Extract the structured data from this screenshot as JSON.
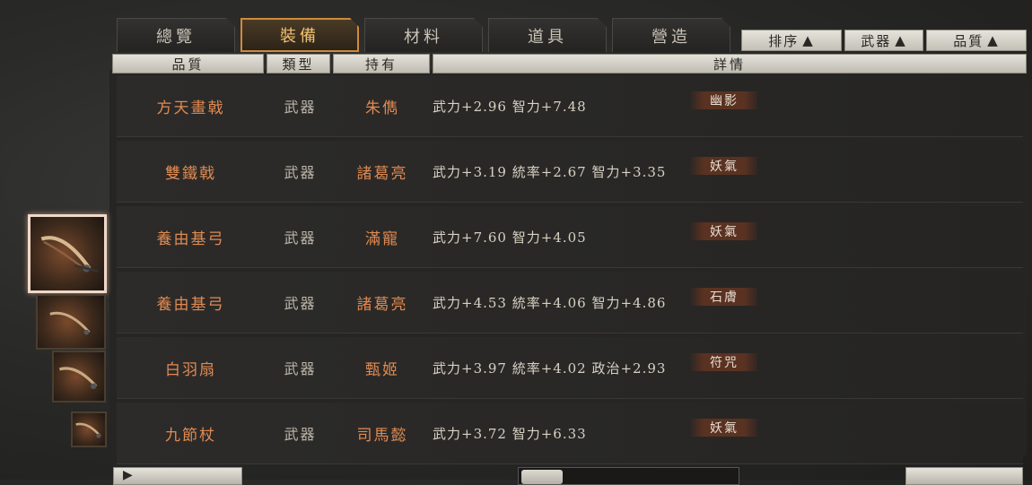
{
  "tabs": [
    {
      "label": "總覽",
      "active": false
    },
    {
      "label": "裝備",
      "active": true
    },
    {
      "label": "材料",
      "active": false
    },
    {
      "label": "道具",
      "active": false
    },
    {
      "label": "營造",
      "active": false
    }
  ],
  "sort_buttons": [
    {
      "label": "排序",
      "icon": "triangle-up-icon"
    },
    {
      "label": "武器",
      "icon": "triangle-up-icon"
    },
    {
      "label": "品質",
      "icon": "triangle-up-icon"
    }
  ],
  "columns": [
    "品質",
    "類型",
    "持有",
    "詳情"
  ],
  "rows": [
    {
      "name": "方天畫戟",
      "type": "武器",
      "owner": "朱儁",
      "stats": "武力+2.96  智力+7.48",
      "tag": "幽影"
    },
    {
      "name": "雙鐵戟",
      "type": "武器",
      "owner": "諸葛亮",
      "stats": "武力+3.19  統率+2.67  智力+3.35",
      "tag": "妖氣"
    },
    {
      "name": "養由基弓",
      "type": "武器",
      "owner": "滿寵",
      "stats": "武力+7.60  智力+4.05",
      "tag": "妖氣"
    },
    {
      "name": "養由基弓",
      "type": "武器",
      "owner": "諸葛亮",
      "stats": "武力+4.53  統率+4.06  智力+4.86",
      "tag": "石膚"
    },
    {
      "name": "白羽扇",
      "type": "武器",
      "owner": "甄姬",
      "stats": "武力+3.97  統率+4.02  政治+2.93",
      "tag": "符咒"
    },
    {
      "name": "九節杖",
      "type": "武器",
      "owner": "司馬懿",
      "stats": "武力+3.72  智力+6.33",
      "tag": "妖氣"
    }
  ],
  "thumbnails": [
    {
      "icon": "bow-weapon-icon",
      "selected": true
    },
    {
      "icon": "bow-weapon-icon",
      "selected": false
    },
    {
      "icon": "bow-weapon-icon",
      "selected": false
    },
    {
      "icon": "bow-weapon-icon",
      "selected": false
    }
  ],
  "colors": {
    "accent": "#d08a3c",
    "name_text": "#e08a52",
    "tag_bg": "#5a3222"
  }
}
